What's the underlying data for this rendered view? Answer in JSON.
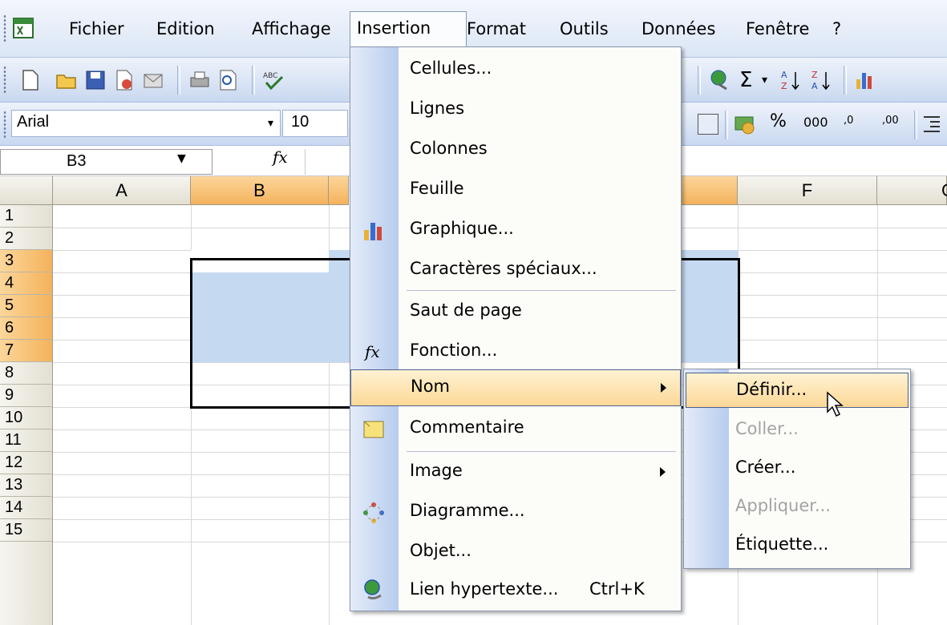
{
  "menubar": {
    "items": [
      {
        "label": "Fichier"
      },
      {
        "label": "Edition"
      },
      {
        "label": "Affichage"
      },
      {
        "label": "Insertion"
      },
      {
        "label": "Format"
      },
      {
        "label": "Outils"
      },
      {
        "label": "Données"
      },
      {
        "label": "Fenêtre"
      },
      {
        "label": "?"
      }
    ]
  },
  "format_toolbar": {
    "font": "Arial",
    "font_size": "10",
    "percent": "%",
    "thousands": "000",
    "inc_decimal": ",0",
    "dec_decimal": ",00"
  },
  "formula_bar": {
    "cell_ref": "B3",
    "fx": "fx"
  },
  "sheet": {
    "columns": [
      "A",
      "B",
      "F",
      "G"
    ],
    "rows": [
      "1",
      "2",
      "3",
      "4",
      "5",
      "6",
      "7",
      "8",
      "9",
      "10",
      "11",
      "12",
      "13",
      "14",
      "15"
    ]
  },
  "insertion_menu": {
    "items": [
      {
        "label": "Cellules..."
      },
      {
        "label": "Lignes"
      },
      {
        "label": "Colonnes"
      },
      {
        "label": "Feuille"
      },
      {
        "label": "Graphique..."
      },
      {
        "label": "Caractères spéciaux..."
      },
      {
        "label": "Saut de page"
      },
      {
        "label": "Fonction..."
      },
      {
        "label": "Nom"
      },
      {
        "label": "Commentaire"
      },
      {
        "label": "Image"
      },
      {
        "label": "Diagramme..."
      },
      {
        "label": "Objet..."
      },
      {
        "label": "Lien hypertexte..."
      }
    ],
    "hyperlink_shortcut": "Ctrl+K"
  },
  "nom_submenu": {
    "items": [
      {
        "label": "Définir..."
      },
      {
        "label": "Coller..."
      },
      {
        "label": "Créer..."
      },
      {
        "label": "Appliquer..."
      },
      {
        "label": "Étiquette..."
      }
    ]
  },
  "colors": {
    "selection_fill": "#c5d9f1",
    "highlight": "#fcd896",
    "header_selected": "#f4b25c"
  }
}
